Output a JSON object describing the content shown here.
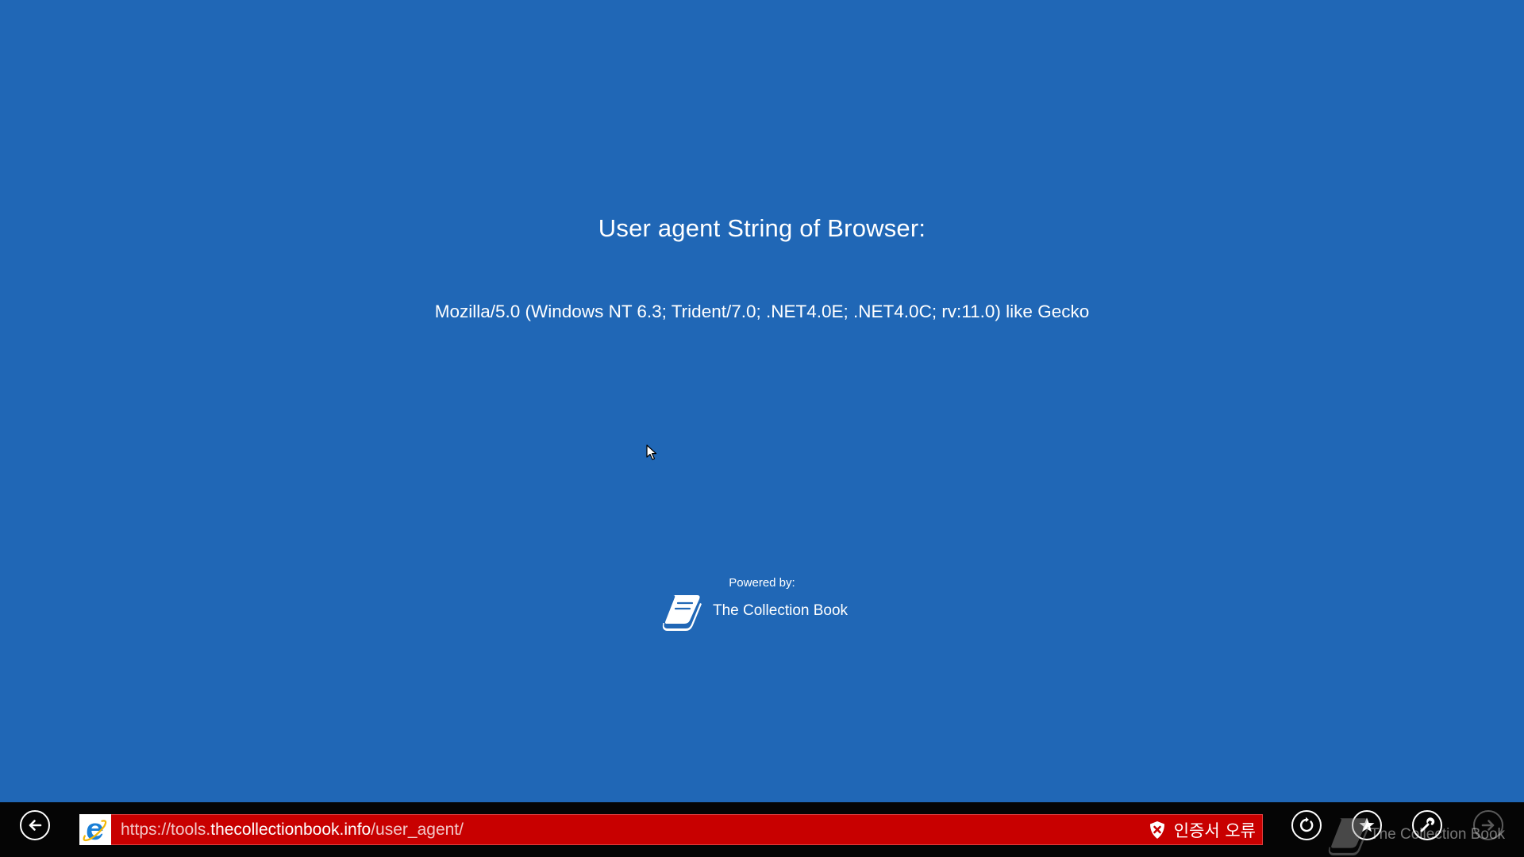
{
  "page": {
    "background_color": "#2067b6",
    "heading": "User agent String of Browser:",
    "user_agent": "Mozilla/5.0 (Windows NT 6.3; Trident/7.0; .NET4.0E; .NET4.0C; rv:11.0) like Gecko",
    "powered_by_label": "Powered by:",
    "brand_name": "The Collection Book",
    "brand_icon": "book-icon"
  },
  "appbar": {
    "background_color": "#050505",
    "back_icon": "back-arrow-icon",
    "site_icon": "internet-explorer-icon",
    "url": {
      "prefix": "https://tools.",
      "host": "thecollectionbook.info",
      "path": "/user_agent/"
    },
    "address_bar_color": "#c80000",
    "cert_error_icon": "shield-x-icon",
    "cert_error_label": "인증서 오류",
    "refresh_icon": "refresh-icon",
    "favorites_icon": "star-icon",
    "tools_icon": "wrench-icon",
    "forward_icon": "forward-arrow-icon",
    "watermark_text": "The Collection Book"
  }
}
